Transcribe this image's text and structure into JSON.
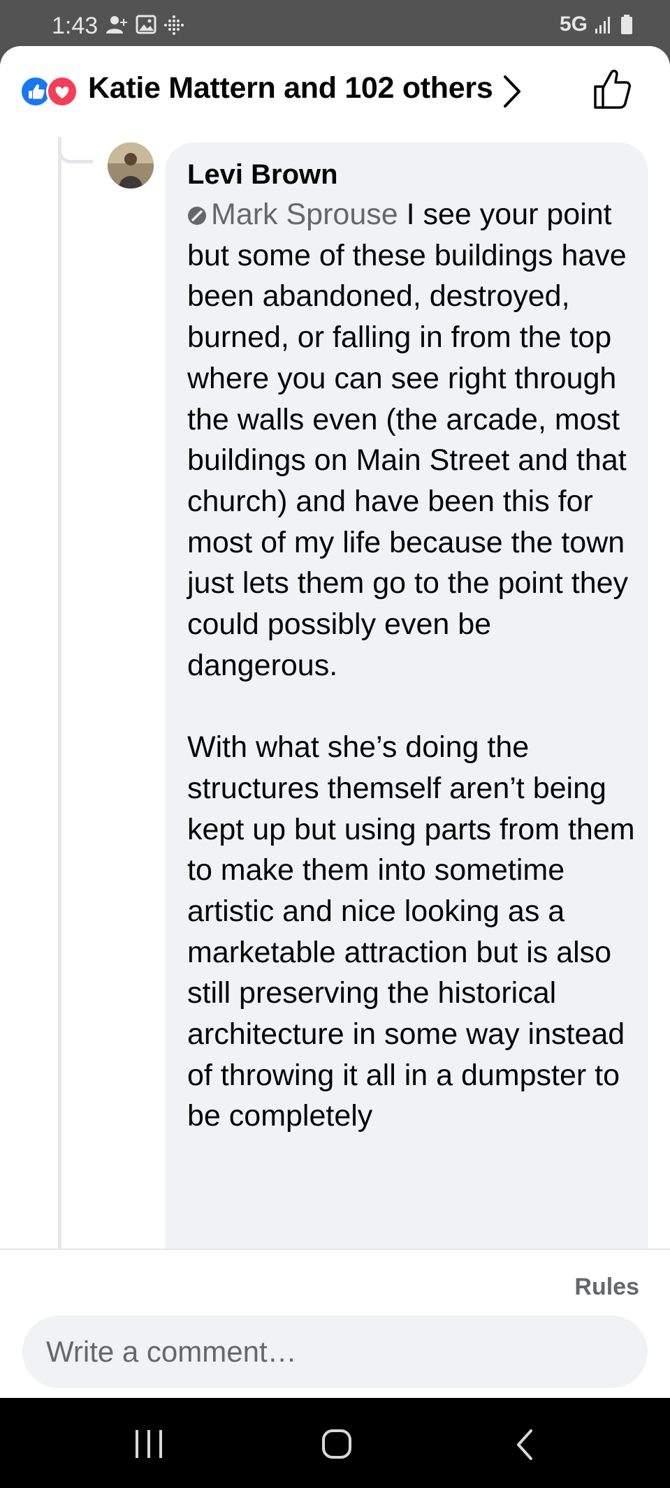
{
  "status_bar": {
    "time": "1:43",
    "network": "5G",
    "icons": [
      "person-add-icon",
      "image-icon",
      "app-grid-icon",
      "signal-icon",
      "battery-icon"
    ]
  },
  "header": {
    "reactions": [
      "like-icon",
      "love-icon"
    ],
    "reactors_text": "Katie Mattern and 102 others",
    "like_button_icon": "thumbs-up-icon"
  },
  "comment": {
    "author": "Levi Brown",
    "mention": "Mark Sprouse",
    "text_after_mention": " I see your point but some of these buildings have been abandoned, destroyed, burned, or falling in from the top where you can see right through the walls even (the arcade, most buildings on Main Street and that church) and have been this for most of my life because the town just lets them go to the point they could possibly even be dangerous.",
    "paragraph_2": "With what she’s doing the structures themself aren’t being kept up but using parts from them to make them into sometime artistic and nice looking as a marketable attraction but is also still preserving the historical architecture in some way instead of throwing it all in a dumpster to be completely"
  },
  "footer": {
    "rules_label": "Rules",
    "input_placeholder": "Write a comment…"
  },
  "nav_bar": {
    "buttons": [
      "recent-apps-icon",
      "home-icon",
      "back-icon"
    ]
  },
  "colors": {
    "facebook_blue": "#1877f2",
    "love_red": "#f33e58",
    "bubble_bg": "#f0f2f5",
    "secondary_text": "#65676b"
  }
}
